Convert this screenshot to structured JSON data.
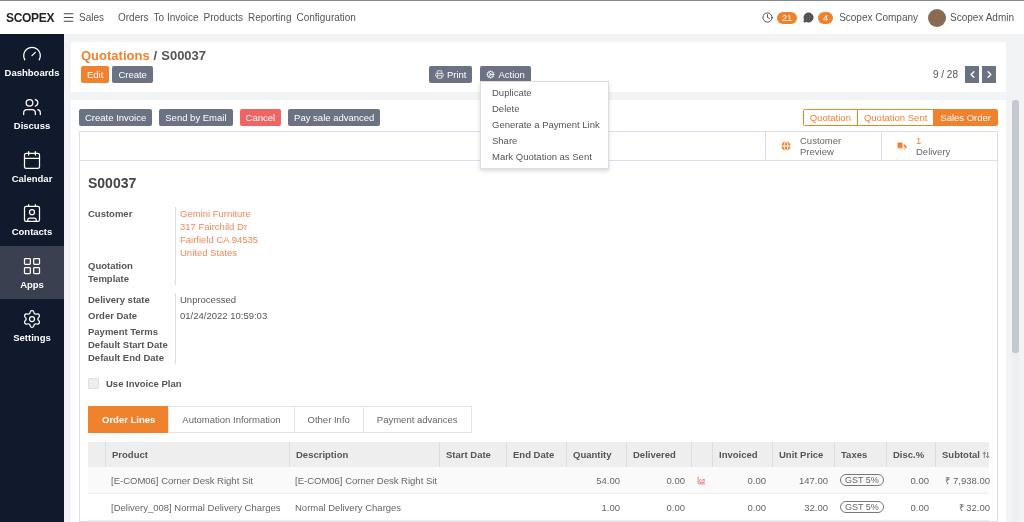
{
  "brand": {
    "logo": "SCOPEX",
    "app": "Sales"
  },
  "menu": [
    "Orders",
    "To Invoice",
    "Products",
    "Reporting",
    "Configuration"
  ],
  "systray": {
    "activities": "21",
    "messages": "4",
    "company": "Scopex Company",
    "user": "Scopex Admin"
  },
  "sidebar": {
    "items": [
      {
        "label": "Dashboards",
        "kind": "gauge",
        "selected": false
      },
      {
        "label": "Discuss",
        "kind": "people",
        "selected": false
      },
      {
        "label": "Calendar",
        "kind": "calendar",
        "selected": false
      },
      {
        "label": "Contacts",
        "kind": "contact",
        "selected": false
      },
      {
        "label": "Apps",
        "kind": "grid",
        "selected": true
      },
      {
        "label": "Settings",
        "kind": "gear",
        "selected": false
      }
    ]
  },
  "breadcrumb": {
    "parent": "Quotations",
    "separator": "/",
    "current": "S00037"
  },
  "buttons": [
    {
      "label": "Edit",
      "kind": "primary"
    },
    {
      "label": "Create",
      "kind": "secondary"
    }
  ],
  "print": "Print",
  "action": "Action",
  "pager": "9 / 28",
  "action_menu": [
    "Duplicate",
    "Delete",
    "Generate a Payment Link",
    "Share",
    "Mark Quotation as Sent"
  ],
  "header_buttons": [
    {
      "label": "Create Invoice",
      "kind": "secondary"
    },
    {
      "label": "Send by Email",
      "kind": "secondary"
    },
    {
      "label": "Cancel",
      "kind": "danger"
    },
    {
      "label": "Pay sale advanced",
      "kind": "secondary"
    }
  ],
  "status_steps": [
    {
      "label": "Quotation",
      "selected": false
    },
    {
      "label": "Quotation Sent",
      "selected": false
    },
    {
      "label": "Sales Order",
      "selected": true
    }
  ],
  "smart_buttons": [
    {
      "kind": "globe",
      "label": "Customer Preview"
    },
    {
      "kind": "truck",
      "value": "1",
      "label": "Delivery"
    }
  ],
  "title": "S00037",
  "customer_group": [
    {
      "label": "Customer",
      "lines": [
        "Gemini Furniture",
        "317 Fairchild Dr",
        "Fairfield CA 94535",
        "United States"
      ]
    },
    {
      "label": "Quotation Template"
    }
  ],
  "info_group": [
    {
      "label": "Delivery state",
      "value": "Unprocessed"
    },
    {
      "label": "Order Date",
      "value": "01/24/2022 10:59:03"
    },
    {
      "label": "Payment Terms"
    },
    {
      "label": "Default Start Date"
    },
    {
      "label": "Default End Date"
    }
  ],
  "invoice_plan": {
    "label": "Use Invoice Plan",
    "checked": false
  },
  "tabs": [
    {
      "label": "Order Lines",
      "selected": true
    },
    {
      "label": "Automation Information",
      "selected": false
    },
    {
      "label": "Other Info",
      "selected": false
    },
    {
      "label": "Payment advances",
      "selected": false
    }
  ],
  "table": {
    "columns": [
      "Product",
      "Description",
      "Start Date",
      "End Date",
      "Quantity",
      "Delivered",
      "Invoiced",
      "Unit Price",
      "Taxes",
      "Disc.%",
      "Subtotal"
    ],
    "rows": [
      {
        "product": "[E-COM06] Corner Desk Right Sit",
        "description": "[E-COM06] Corner Desk Right Sit",
        "start_date": "",
        "end_date": "",
        "quantity": "54.00",
        "delivered": "0.00",
        "forecast_warning": true,
        "invoiced": "0.00",
        "unit_price": "147.00",
        "taxes": "GST 5%",
        "discount": "0.00",
        "subtotal": "₹ 7,938.00"
      },
      {
        "product": "[Delivery_008] Normal Delivery Charges",
        "description": "Normal Delivery Charges",
        "start_date": "",
        "end_date": "",
        "quantity": "1.00",
        "delivered": "0.00",
        "forecast_warning": false,
        "invoiced": "0.00",
        "unit_price": "32.00",
        "taxes": "GST 5%",
        "discount": "0.00",
        "subtotal": "₹ 32.00"
      }
    ]
  }
}
